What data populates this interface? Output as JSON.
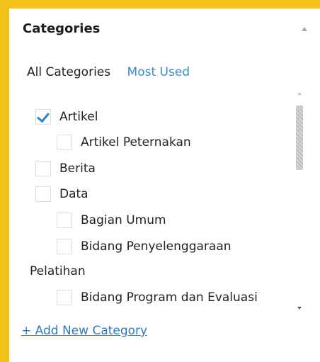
{
  "panel": {
    "title": "Categories",
    "collapse_icon": "chevron-up-icon"
  },
  "tabs": [
    {
      "label": "All Categories",
      "active": true
    },
    {
      "label": "Most Used",
      "active": false
    }
  ],
  "categories": [
    {
      "label": "Artikel",
      "checked": true
    },
    {
      "label": "Artikel Peternakan",
      "checked": false
    },
    {
      "label": "Berita",
      "checked": false
    },
    {
      "label": "Data",
      "checked": false
    },
    {
      "label": "Bagian Umum",
      "checked": false
    },
    {
      "label": "Bidang Penyelenggaraan",
      "label_continued": "Pelatihan",
      "checked": false
    },
    {
      "label": "Bidang Program dan Evaluasi",
      "checked": false
    }
  ],
  "add_category": {
    "label": "+ Add New Category"
  },
  "colors": {
    "background": "#f3c21a",
    "link": "#3a8cc3",
    "checkmark": "#2f80c2"
  }
}
